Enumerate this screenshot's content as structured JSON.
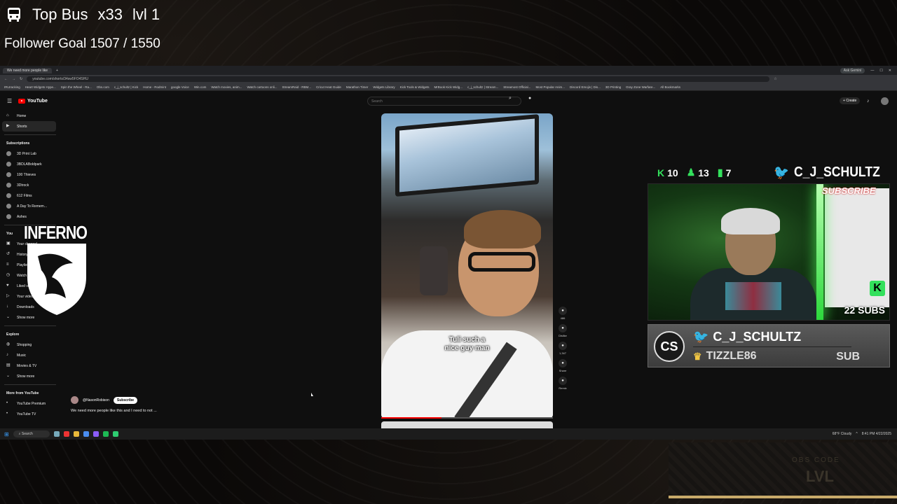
{
  "overlay": {
    "top_bus": {
      "label": "Top Bus",
      "count": "x33",
      "level": "lvl 1",
      "icon": "bus-icon"
    },
    "follower_goal": "Follower Goal 1507 / 1550",
    "inferno_logo_text": "INFERNO"
  },
  "browser": {
    "tab_title": "We need more people like",
    "ask_gemini": "Ask Gemini",
    "url": "youtube.com/shorts/34sw5FO4SHU",
    "bookmarks": [
      "IRLtracking",
      "Heart Widgets Hype...",
      "Spin the Wheel - Ra...",
      "Obs.com",
      "c_j_schultz | Kick",
      "Home - Rodmint",
      "google Voice",
      "Win.com",
      "Watch movies, anim...",
      "Watch cartoons onli...",
      "StreamRaid - RBM...",
      "Cricut Heat Guide",
      "Marathon Timer",
      "Widgets Library",
      "Kick Tools & Widgets",
      "MrBook Kick Widg...",
      "c_j_schultz | Stream...",
      "Streamost Official...",
      "Most Popular Anim...",
      "Discord Emojis | Dis...",
      "3D Printing",
      "Gray Zone Warfare...",
      "All Bookmarks"
    ]
  },
  "youtube": {
    "logo": "YouTube",
    "search_placeholder": "Search",
    "create_label": "Create",
    "sidebar": {
      "main": [
        {
          "label": "Home",
          "icon": "home-icon"
        },
        {
          "label": "Shorts",
          "icon": "shorts-icon"
        }
      ],
      "subscriptions_header": "Subscriptions",
      "subscriptions": [
        "3D Print Lab",
        "3BDLABoldpark",
        "100 Thieves",
        "3Dtrock",
        "612 Films",
        "A Day To Remem...",
        "Ashes"
      ],
      "you_header": "You",
      "you_items": [
        {
          "label": "Your channel",
          "icon": "channel-icon"
        },
        {
          "label": "History",
          "icon": "history-icon"
        },
        {
          "label": "Playlists",
          "icon": "playlist-icon"
        },
        {
          "label": "Watch later",
          "icon": "clock-icon"
        },
        {
          "label": "Liked videos",
          "icon": "like-icon"
        },
        {
          "label": "Your videos",
          "icon": "video-icon"
        },
        {
          "label": "Downloads",
          "icon": "download-icon"
        },
        {
          "label": "Show more",
          "icon": "chevron-down-icon"
        }
      ],
      "explore_header": "Explore",
      "explore_items": [
        {
          "label": "Shopping",
          "icon": "bag-icon"
        },
        {
          "label": "Music",
          "icon": "music-icon"
        },
        {
          "label": "Movies & TV",
          "icon": "film-icon"
        },
        {
          "label": "Show more",
          "icon": "chevron-down-icon"
        }
      ],
      "more_header": "More from YouTube",
      "more_items": [
        "YouTube Premium",
        "YouTube TV"
      ]
    },
    "short": {
      "caption_line1": "Tuli such a",
      "caption_line2": "nice guy man",
      "channel": "@NasonRobison",
      "subscribe_label": "Subscribe",
      "description": "We need more people like this and I need to not ...",
      "progress": 0.35,
      "actions": [
        {
          "icon": "like-icon",
          "count": "486"
        },
        {
          "icon": "dislike-icon",
          "count": "Dislike"
        },
        {
          "icon": "comment-icon",
          "count": "1,347"
        },
        {
          "icon": "share-icon",
          "count": "Share"
        },
        {
          "icon": "remix-icon",
          "count": "Remix"
        }
      ]
    }
  },
  "taskbar": {
    "search_label": "Search",
    "weather": "68°F",
    "weather_sub": "Cloudy",
    "time": "8:41 PM",
    "date": "4/22/2025"
  },
  "stream_panel": {
    "kick_count": "10",
    "viewer_count": "13",
    "chart_count": "7",
    "twitter_handle": "C_J_SCHULTZ",
    "webcam_subs": "22 SUBS",
    "webcam_banner": "SUBSCRIBE",
    "alert_name": "C_J_SCHULTZ",
    "alert_user": "TIZZLE86",
    "alert_type": "SUB",
    "alert_logo": "CS"
  },
  "level_panel": {
    "label": "OBS CODE",
    "level": "LVL"
  },
  "colors": {
    "kick_green": "#33e05c",
    "twitter_blue": "#1da1f2",
    "yt_red": "#ff0000",
    "gold": "#c8aa6a"
  }
}
